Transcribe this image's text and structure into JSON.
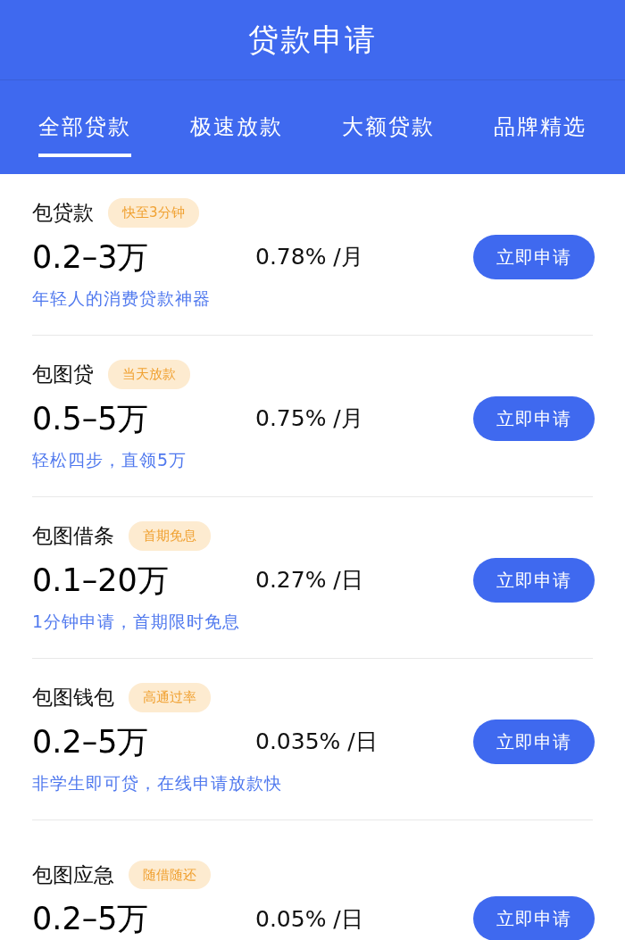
{
  "title": "贷款申请",
  "tabs": [
    {
      "label": "全部贷款",
      "selected": true
    },
    {
      "label": "极速放款",
      "selected": false
    },
    {
      "label": "大额贷款",
      "selected": false
    },
    {
      "label": "品牌精选",
      "selected": false
    }
  ],
  "loans": [
    {
      "name": "包贷款",
      "tag": "快至3分钟",
      "amount": "0.2–3万",
      "rate": "0.78%",
      "unit": "/月",
      "description": "年轻人的消费贷款神器",
      "button": "立即申请"
    },
    {
      "name": "包图贷",
      "tag": "当天放款",
      "amount": "0.5–5万",
      "rate": "0.75%",
      "unit": "/月",
      "description": "轻松四步，直领5万",
      "button": "立即申请"
    },
    {
      "name": "包图借条",
      "tag": "首期免息",
      "amount": "0.1–20万",
      "rate": "0.27%",
      "unit": "/日",
      "description": "1分钟申请，首期限时免息",
      "button": "立即申请"
    },
    {
      "name": "包图钱包",
      "tag": "高通过率",
      "amount": "0.2–5万",
      "rate": "0.035%",
      "unit": "/日",
      "description": "非学生即可贷，在线申请放款快",
      "button": "立即申请"
    },
    {
      "name": "包图应急",
      "tag": "随借随还",
      "amount": "0.2–5万",
      "rate": "0.05%",
      "unit": "/日",
      "button": "立即申请"
    }
  ]
}
